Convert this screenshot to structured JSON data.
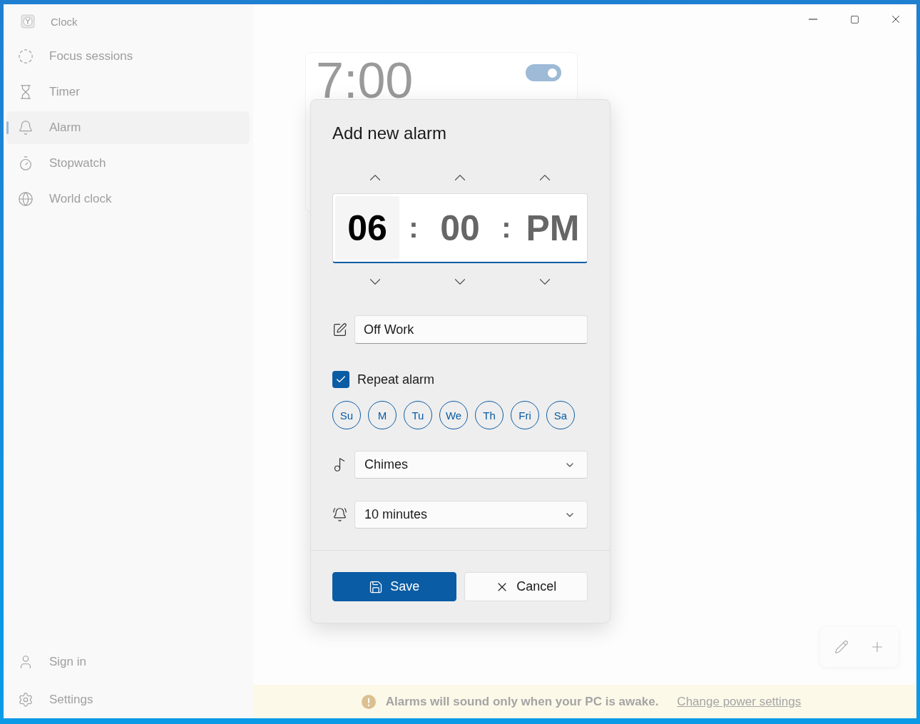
{
  "app": {
    "title": "Clock"
  },
  "nav": [
    {
      "label": "Focus sessions",
      "selected": false
    },
    {
      "label": "Timer",
      "selected": false
    },
    {
      "label": "Alarm",
      "selected": true
    },
    {
      "label": "Stopwatch",
      "selected": false
    },
    {
      "label": "World clock",
      "selected": false
    }
  ],
  "nav_footer": [
    {
      "label": "Sign in"
    },
    {
      "label": "Settings"
    }
  ],
  "alarm_card": {
    "time": "7:00",
    "on": true
  },
  "dialog": {
    "title": "Add new alarm",
    "time_segments": [
      {
        "value": "06",
        "selected": true
      },
      {
        "value": "00",
        "selected": false
      },
      {
        "value": "PM",
        "selected": false
      }
    ],
    "separators": [
      ":",
      ":"
    ],
    "name": {
      "value": "Off Work"
    },
    "repeat": {
      "label": "Repeat alarm",
      "checked": true
    },
    "days": [
      {
        "label": "Su",
        "selected": false
      },
      {
        "label": "M",
        "selected": false
      },
      {
        "label": "Tu",
        "selected": false
      },
      {
        "label": "We",
        "selected": false
      },
      {
        "label": "Th",
        "selected": false
      },
      {
        "label": "Fri",
        "selected": false
      },
      {
        "label": "Sa",
        "selected": false
      }
    ],
    "sound": {
      "value": "Chimes"
    },
    "snooze": {
      "value": "10 minutes"
    },
    "buttons": [
      {
        "label": "Save",
        "kind": "primary"
      },
      {
        "label": "Cancel",
        "kind": "secondary"
      }
    ]
  },
  "notice": {
    "message": "Alarms will sound only when your PC is awake.",
    "link": "Change power settings"
  }
}
